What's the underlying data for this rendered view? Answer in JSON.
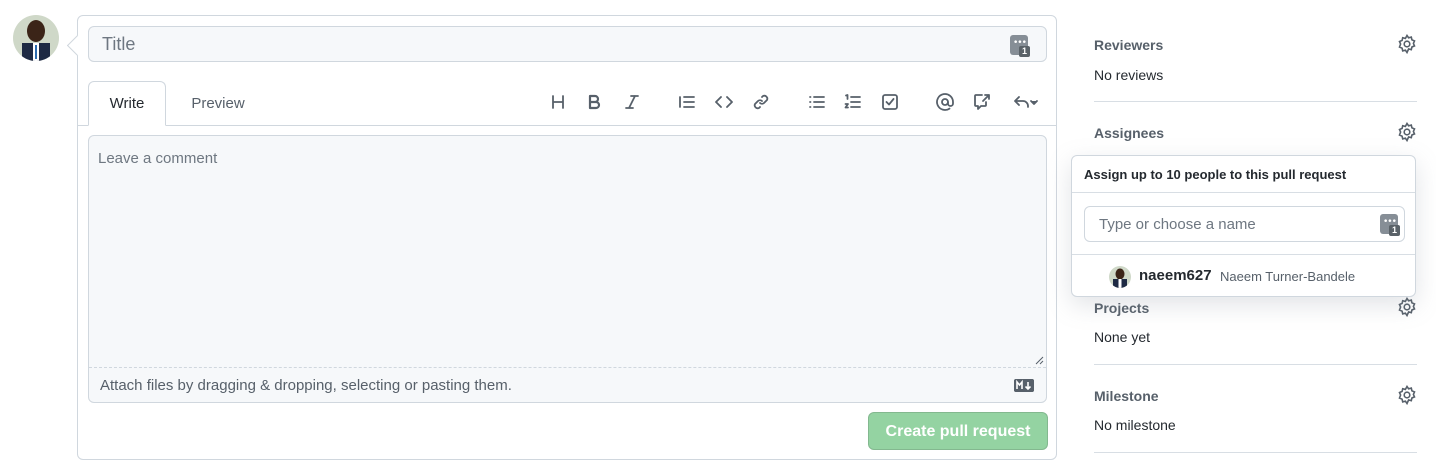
{
  "author": {
    "avatar_alt": "Author avatar"
  },
  "form": {
    "title_placeholder": "Title",
    "tabs": {
      "write": "Write",
      "preview": "Preview"
    },
    "toolbar": [
      "heading-icon",
      "bold-icon",
      "italic-icon",
      "quote-icon",
      "code-icon",
      "link-icon",
      "bulleted-list-icon",
      "numbered-list-icon",
      "task-list-icon",
      "mention-icon",
      "cross-reference-icon",
      "saved-replies-icon"
    ],
    "comment_placeholder": "Leave a comment",
    "attach_text": "Attach files by dragging & dropping, selecting or pasting them.",
    "submit_label": "Create pull request"
  },
  "sidebar": {
    "reviewers": {
      "heading": "Reviewers",
      "value": "No reviews"
    },
    "assignees": {
      "heading": "Assignees"
    },
    "projects": {
      "heading": "Projects",
      "value": "None yet"
    },
    "milestone": {
      "heading": "Milestone",
      "value": "No milestone"
    }
  },
  "assign_popover": {
    "header": "Assign up to 10 people to this pull request",
    "filter_placeholder": "Type or choose a name",
    "users": [
      {
        "login": "naeem627",
        "name": "Naeem Turner-Bandele"
      }
    ]
  },
  "colors": {
    "create_button_disabled": "#94d3a2",
    "border": "#d0d7de",
    "muted_text": "#57606a",
    "input_bg": "#f6f8fa"
  }
}
